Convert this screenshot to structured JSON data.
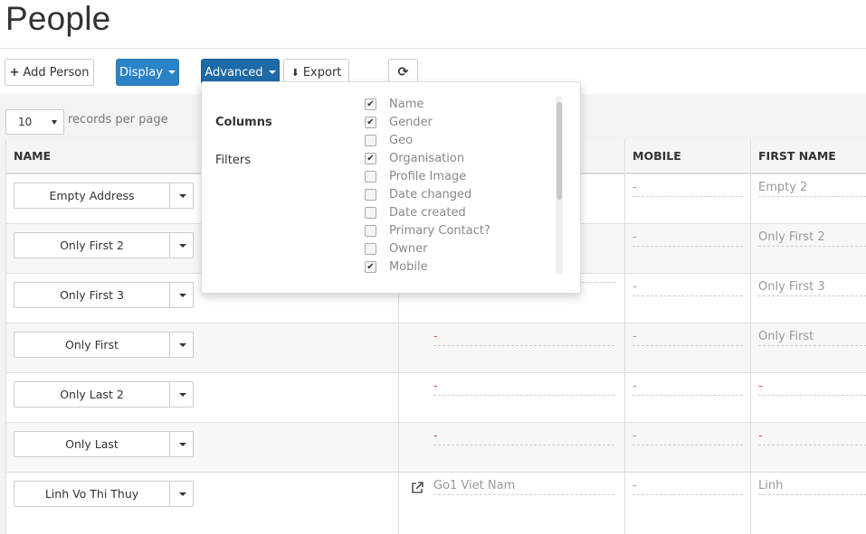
{
  "page": {
    "title": "People"
  },
  "toolbar": {
    "add_person": "Add Person",
    "display": "Display",
    "advanced": "Advanced",
    "export": "Export",
    "refresh_icon": "refresh-icon"
  },
  "records": {
    "value": "10",
    "label": "records per page"
  },
  "columns": {
    "name": "NAME",
    "mobile": "MOBILE",
    "first_name": "FIRST NAME"
  },
  "rows": [
    {
      "name": "Empty Address",
      "org": "",
      "mobile": "-",
      "first": "Empty 2"
    },
    {
      "name": "Only First 2",
      "org": "",
      "mobile": "-",
      "first": "Only First 2"
    },
    {
      "name": "Only First 3",
      "org": "",
      "mobile": "-",
      "first": "Only First 3"
    },
    {
      "name": "Only First",
      "org": "-",
      "mobile": "-",
      "first": "Only First"
    },
    {
      "name": "Only Last 2",
      "org": "-",
      "mobile": "-",
      "first": "-"
    },
    {
      "name": "Only Last",
      "org": "-",
      "mobile": "-",
      "first": "-"
    },
    {
      "name": "Linh Vo Thi Thuy",
      "org": "Go1 Viet Nam",
      "mobile": "-",
      "first": "Linh"
    }
  ],
  "advanced_dropdown": {
    "columns_label": "Columns",
    "filters_label": "Filters",
    "options": [
      {
        "label": "Name",
        "checked": true
      },
      {
        "label": "Gender",
        "checked": true
      },
      {
        "label": "Geo",
        "checked": false
      },
      {
        "label": "Organisation",
        "checked": true
      },
      {
        "label": "Profile Image",
        "checked": false
      },
      {
        "label": "Date changed",
        "checked": false
      },
      {
        "label": "Date created",
        "checked": false
      },
      {
        "label": "Primary Contact?",
        "checked": false
      },
      {
        "label": "Owner",
        "checked": false
      },
      {
        "label": "Mobile",
        "checked": true
      }
    ]
  },
  "colors": {
    "primary": "#2a83c6",
    "primary_dark": "#1c6aa8",
    "danger": "#d9534f"
  }
}
